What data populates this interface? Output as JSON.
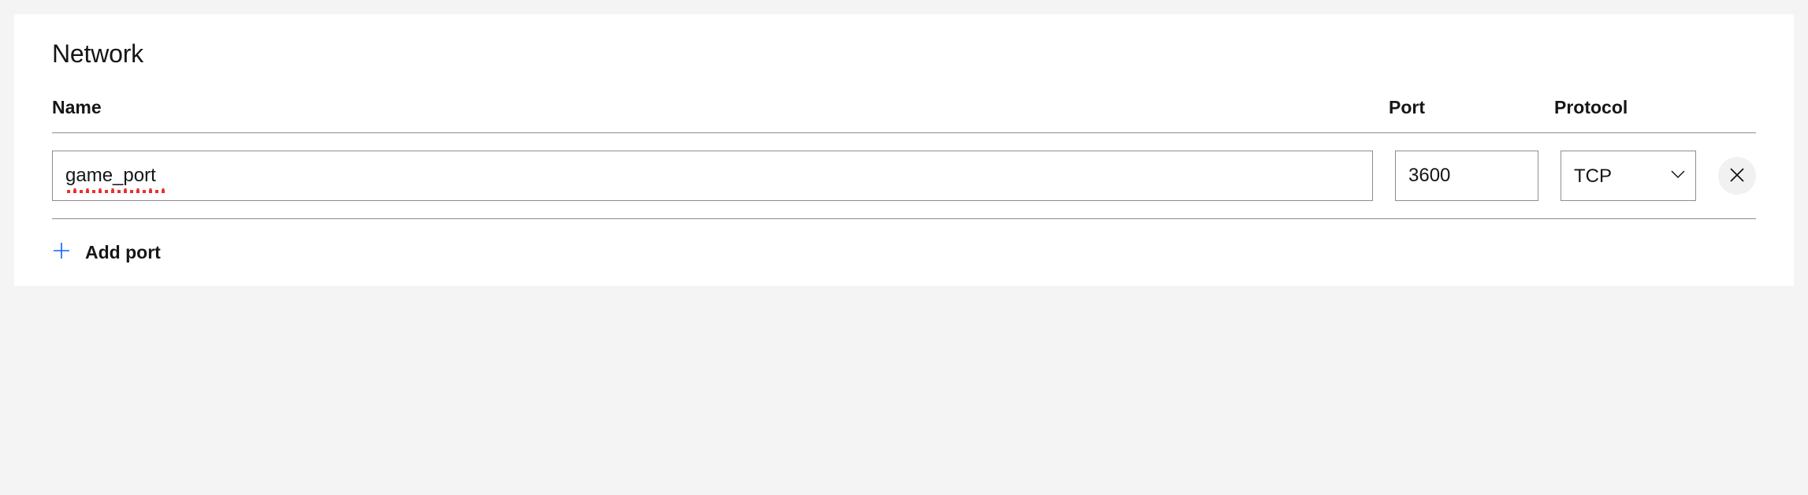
{
  "section": {
    "title": "Network"
  },
  "headers": {
    "name": "Name",
    "port": "Port",
    "protocol": "Protocol"
  },
  "rows": [
    {
      "name": "game_port",
      "port": "3600",
      "protocol": "TCP"
    }
  ],
  "actions": {
    "add_port": "Add port"
  }
}
